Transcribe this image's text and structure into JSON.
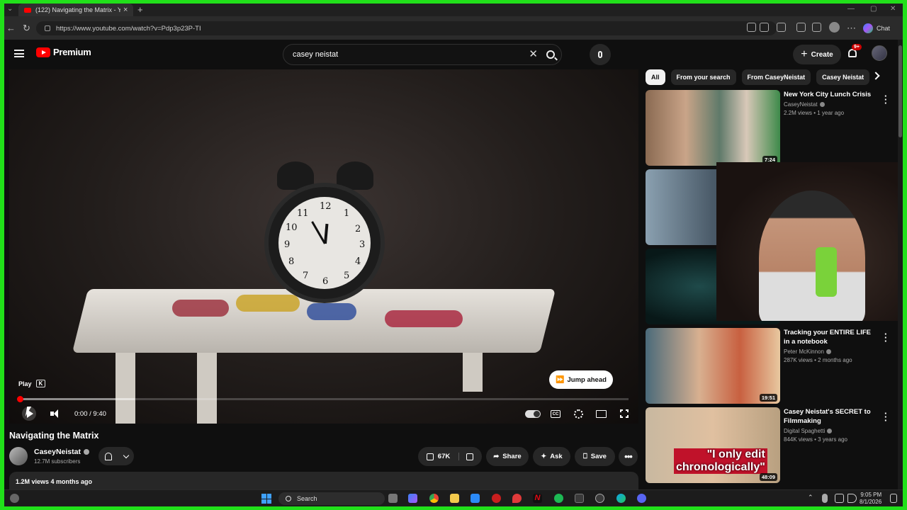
{
  "browser": {
    "tab_title": "(122) Navigating the Matrix - YouT",
    "url": "https://www.youtube.com/watch?v=Pdp3p23P-TI",
    "chat_label": "Chat"
  },
  "header": {
    "logo_text": "Premium",
    "search_value": "casey neistat",
    "create_label": "Create",
    "notif_badge": "9+"
  },
  "player": {
    "tooltip_label": "Play",
    "tooltip_key": "K",
    "jump_label": "Jump ahead",
    "time": "0:00 / 9:40",
    "progress_played": 0.0,
    "progress_buffered": 0.19,
    "clock_numbers": [
      "12",
      "1",
      "2",
      "3",
      "4",
      "5",
      "6",
      "7",
      "8",
      "9",
      "10",
      "11"
    ]
  },
  "video": {
    "title": "Navigating the Matrix",
    "channel": "CaseyNeistat",
    "subscribers": "12.7M subscribers",
    "likes": "67K",
    "share_label": "Share",
    "ask_label": "Ask",
    "save_label": "Save",
    "views_date": "1.2M views  4 months ago"
  },
  "chips": [
    "All",
    "From your search",
    "From CaseyNeistat",
    "Casey Neistat"
  ],
  "recommendations": [
    {
      "title": "New York City Lunch Crisis",
      "channel": "CaseyNeistat",
      "views": "2.2M views • 1 year ago",
      "duration": "7:24"
    },
    {
      "title": "Tracking your ENTIRE LIFE in a notebook",
      "channel": "Peter McKinnon",
      "views": "287K views • 2 months ago",
      "duration": "19:51"
    },
    {
      "title": "Casey Neistat's SECRET to Filmmaking",
      "channel": "Digital Spaghetti",
      "views": "844K views • 3 years ago",
      "duration": "48:09"
    }
  ],
  "thumb_overlay_text": {
    "rec3_caption_1": "\"I only edit",
    "rec3_caption_2": "chronologically\""
  },
  "taskbar": {
    "search_label": "Search",
    "time": "9:05 PM",
    "date": "8/1/2026"
  },
  "colors": {
    "accent_red": "#ff0000",
    "frame_green": "#21e01a",
    "bg": "#0f0f0f"
  }
}
